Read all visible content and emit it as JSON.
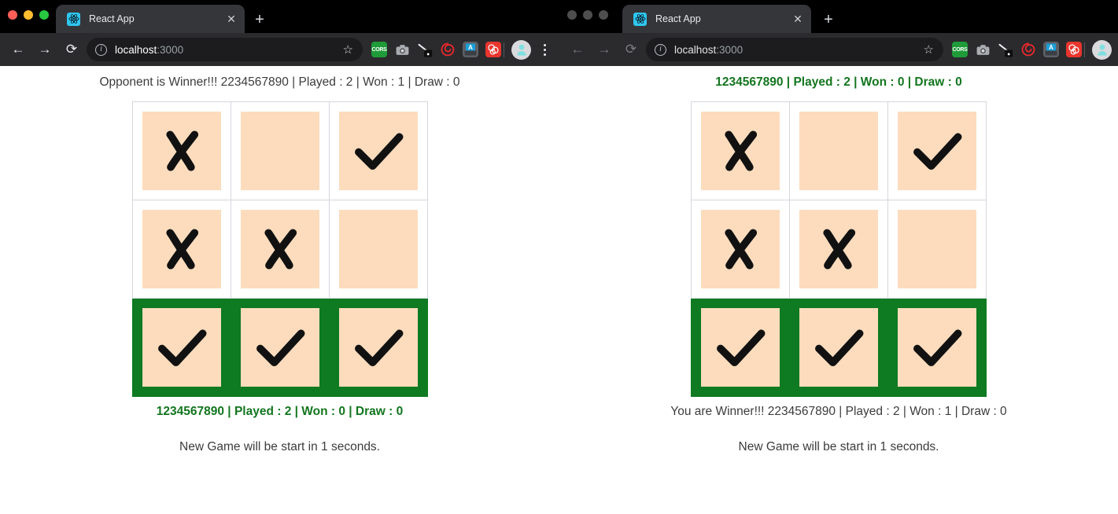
{
  "windows": [
    {
      "id": "left",
      "active": true,
      "tab": {
        "title": "React App",
        "favicon": "react-logo-icon",
        "close_label": "✕",
        "newtab_label": "+"
      },
      "toolbar": {
        "back": "←",
        "forward": "→",
        "reload": "⟳",
        "info_icon": "i",
        "url_host": "localhost",
        "url_port": ":3000",
        "star": "☆",
        "extensions": [
          "cors-extension-icon",
          "camera-extension-icon",
          "pen-extension-icon",
          "spiral-extension-icon",
          "printer-extension-icon",
          "red-extension-icon"
        ],
        "cors_label": "CORS",
        "avatar": "profile-avatar",
        "menu": "three-dot-menu-icon"
      },
      "page": {
        "top_status": "Opponent is Winner!!! 2234567890 | Played : 2 | Won : 1 | Draw : 0",
        "top_status_is_win": false,
        "bottom_status": "1234567890 | Played : 2 | Won : 0 | Draw : 0",
        "bottom_status_is_win": true,
        "timer_text": "New Game will be start in 1 seconds.",
        "board": [
          [
            {
              "mark": "x",
              "winner": false
            },
            {
              "mark": "",
              "winner": false
            },
            {
              "mark": "check",
              "winner": false
            }
          ],
          [
            {
              "mark": "x",
              "winner": false
            },
            {
              "mark": "x",
              "winner": false
            },
            {
              "mark": "",
              "winner": false
            }
          ],
          [
            {
              "mark": "check",
              "winner": true
            },
            {
              "mark": "check",
              "winner": true
            },
            {
              "mark": "check",
              "winner": true
            }
          ]
        ]
      }
    },
    {
      "id": "right",
      "active": false,
      "tab": {
        "title": "React App",
        "favicon": "react-logo-icon",
        "close_label": "✕",
        "newtab_label": "+"
      },
      "toolbar": {
        "back": "←",
        "forward": "→",
        "reload": "⟳",
        "info_icon": "i",
        "url_host": "localhost",
        "url_port": ":3000",
        "star": "☆",
        "extensions": [
          "cors-extension-icon",
          "camera-extension-icon",
          "pen-extension-icon",
          "spiral-extension-icon",
          "printer-extension-icon",
          "red-extension-icon"
        ],
        "cors_label": "CORS",
        "avatar": "profile-avatar",
        "menu": ""
      },
      "page": {
        "top_status": "1234567890 | Played : 2 | Won : 0 | Draw : 0",
        "top_status_is_win": true,
        "bottom_status": "You are Winner!!! 2234567890 | Played : 2 | Won : 1 | Draw : 0",
        "bottom_status_is_win": false,
        "timer_text": "New Game will be start in 1 seconds.",
        "board": [
          [
            {
              "mark": "x",
              "winner": false
            },
            {
              "mark": "",
              "winner": false
            },
            {
              "mark": "check",
              "winner": false
            }
          ],
          [
            {
              "mark": "x",
              "winner": false
            },
            {
              "mark": "x",
              "winner": false
            },
            {
              "mark": "",
              "winner": false
            }
          ],
          [
            {
              "mark": "check",
              "winner": true
            },
            {
              "mark": "check",
              "winner": true
            },
            {
              "mark": "check",
              "winner": true
            }
          ]
        ]
      }
    }
  ],
  "colors": {
    "winner_green": "#0e7a21",
    "win_text_green": "#13761f",
    "cell_fill": "#fcdcbd",
    "cell_border": "#d5d6dd",
    "chrome_tabstrip": "#000000",
    "chrome_toolbar": "#2b2b2e",
    "favicon_blue": "#2ec7f0"
  }
}
